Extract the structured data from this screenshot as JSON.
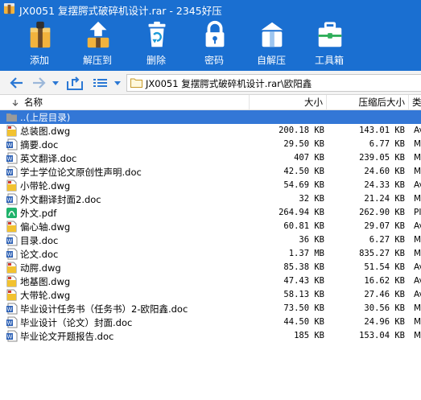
{
  "window": {
    "title": "JX0051 复摆腭式破碎机设计.rar - 2345好压"
  },
  "toolbar": {
    "items": [
      {
        "label": "添加",
        "icon": "add-archive-icon"
      },
      {
        "label": "解压到",
        "icon": "extract-to-icon"
      },
      {
        "label": "删除",
        "icon": "delete-icon"
      },
      {
        "label": "密码",
        "icon": "password-lock-icon"
      },
      {
        "label": "自解压",
        "icon": "self-extract-icon"
      },
      {
        "label": "工具箱",
        "icon": "toolbox-icon"
      }
    ]
  },
  "address": {
    "path": "JX0051 复摆腭式破碎机设计.rar\\欧阳鑫"
  },
  "columns": {
    "name": "名称",
    "size": "大小",
    "compressed": "压缩后大小",
    "type": "类"
  },
  "parent_row": {
    "name": "..(上层目录)"
  },
  "files": [
    {
      "name": "总装图.dwg",
      "size": "200.18 KB",
      "compressed": "143.01 KB",
      "type": "Av",
      "icon": "dwg-file-icon"
    },
    {
      "name": "摘要.doc",
      "size": "29.50 KB",
      "compressed": "6.77 KB",
      "type": "Mi",
      "icon": "word-file-icon"
    },
    {
      "name": "英文翻译.doc",
      "size": "407 KB",
      "compressed": "239.05 KB",
      "type": "Mi",
      "icon": "word-file-icon"
    },
    {
      "name": "学士学位论文原创性声明.doc",
      "size": "42.50 KB",
      "compressed": "24.60 KB",
      "type": "Mi",
      "icon": "word-file-icon"
    },
    {
      "name": "小带轮.dwg",
      "size": "54.69 KB",
      "compressed": "24.33 KB",
      "type": "Av",
      "icon": "dwg-file-icon"
    },
    {
      "name": "外文翻译封面2.doc",
      "size": "32 KB",
      "compressed": "21.24 KB",
      "type": "Mi",
      "icon": "word-file-icon"
    },
    {
      "name": "外文.pdf",
      "size": "264.94 KB",
      "compressed": "262.90 KB",
      "type": "PI",
      "icon": "pdf-file-icon"
    },
    {
      "name": "偏心轴.dwg",
      "size": "60.81 KB",
      "compressed": "29.07 KB",
      "type": "Av",
      "icon": "dwg-file-icon"
    },
    {
      "name": "目录.doc",
      "size": "36 KB",
      "compressed": "6.27 KB",
      "type": "Mi",
      "icon": "word-file-icon"
    },
    {
      "name": "论文.doc",
      "size": "1.37 MB",
      "compressed": "835.27 KB",
      "type": "Mi",
      "icon": "word-file-icon"
    },
    {
      "name": "动腭.dwg",
      "size": "85.38 KB",
      "compressed": "51.54 KB",
      "type": "Av",
      "icon": "dwg-file-icon"
    },
    {
      "name": "地基图.dwg",
      "size": "47.43 KB",
      "compressed": "16.62 KB",
      "type": "Av",
      "icon": "dwg-file-icon"
    },
    {
      "name": "大带轮.dwg",
      "size": "58.13 KB",
      "compressed": "27.46 KB",
      "type": "Av",
      "icon": "dwg-file-icon"
    },
    {
      "name": "毕业设计任务书（任务书）2-欧阳鑫.doc",
      "size": "73.50 KB",
      "compressed": "30.56 KB",
      "type": "Mi",
      "icon": "word-file-icon"
    },
    {
      "name": "毕业设计（论文）封面.doc",
      "size": "44.50 KB",
      "compressed": "24.96 KB",
      "type": "Mi",
      "icon": "word-file-icon"
    },
    {
      "name": "毕业论文开题报告.doc",
      "size": "185 KB",
      "compressed": "153.04 KB",
      "type": "Mi",
      "icon": "word-file-icon"
    }
  ],
  "colors": {
    "toolbar_bg": "#1a6fd1",
    "selection": "#3377d6"
  }
}
